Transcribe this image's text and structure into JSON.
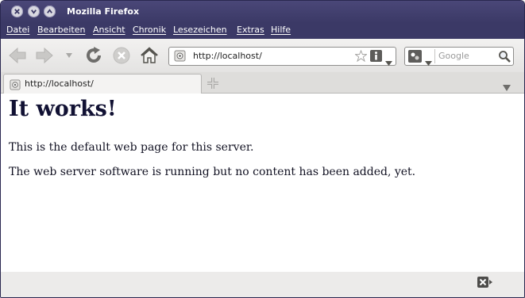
{
  "window": {
    "title": "Mozilla Firefox"
  },
  "menu": [
    "Datei",
    "Bearbeiten",
    "Ansicht",
    "Chronik",
    "Lesezeichen",
    "Extras",
    "Hilfe"
  ],
  "urlbar": {
    "url": "http://localhost/"
  },
  "search": {
    "placeholder": "Google"
  },
  "tab": {
    "label": "http://localhost/"
  },
  "page": {
    "heading": "It works!",
    "paragraphs": [
      "This is the default web page for this server.",
      "The web server software is running but no content has been added, yet."
    ]
  },
  "colors": {
    "titlebar": "#3b3966",
    "accent": "#4a4778",
    "chrome": "#edeceb"
  },
  "icons": [
    "close-icon",
    "minimize-icon",
    "maximize-icon",
    "back-icon",
    "forward-icon",
    "history-dropdown-icon",
    "reload-icon",
    "stop-icon",
    "home-icon",
    "site-identity-icon",
    "bookmark-star-icon",
    "page-info-icon",
    "url-dropdown-icon",
    "search-engine-icon",
    "search-dropdown-icon",
    "search-magnifier-icon",
    "new-tab-icon",
    "tab-list-icon",
    "status-error-icon"
  ]
}
